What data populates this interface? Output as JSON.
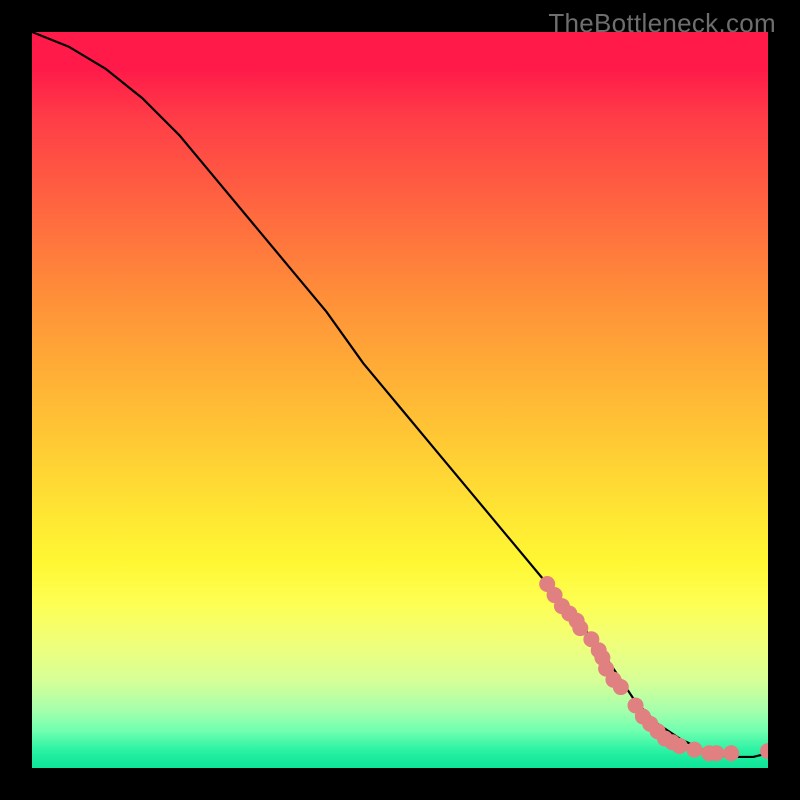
{
  "watermark": "TheBottleneck.com",
  "chart_data": {
    "type": "line",
    "title": "",
    "xlabel": "",
    "ylabel": "",
    "xlim": [
      0,
      100
    ],
    "ylim": [
      0,
      100
    ],
    "curve": {
      "x": [
        0,
        5,
        10,
        15,
        20,
        25,
        30,
        35,
        40,
        45,
        50,
        55,
        60,
        65,
        70,
        75,
        78,
        80,
        82,
        85,
        88,
        90,
        92,
        95,
        98,
        100
      ],
      "y": [
        100,
        98,
        95,
        91,
        86,
        80,
        74,
        68,
        62,
        55,
        49,
        43,
        37,
        31,
        25,
        19,
        15,
        12,
        9,
        6,
        4,
        3,
        2,
        1.5,
        1.5,
        2
      ]
    },
    "markers": {
      "x": [
        70,
        71,
        72,
        73,
        74,
        74.5,
        76,
        77,
        77.5,
        78,
        79,
        80,
        82,
        83,
        84,
        85,
        86,
        87,
        88,
        90,
        92,
        93,
        95,
        100
      ],
      "y": [
        25,
        23.5,
        22,
        21,
        20,
        19,
        17.5,
        16,
        15,
        13.5,
        12,
        11,
        8.5,
        7,
        6,
        5,
        4,
        3.5,
        3,
        2.5,
        2,
        2,
        2,
        2.3
      ]
    },
    "colors": {
      "curve": "#000000",
      "marker_fill": "#e08080",
      "marker_stroke": "#e08080"
    }
  }
}
